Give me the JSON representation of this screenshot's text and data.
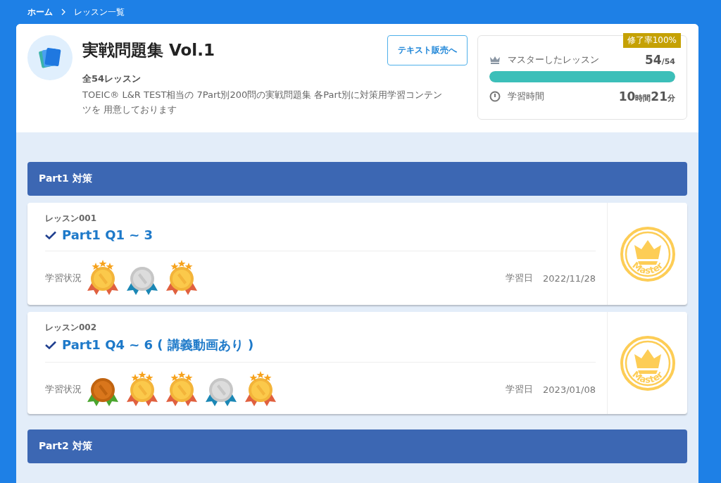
{
  "breadcrumb": [
    {
      "label": "ホーム",
      "current": false
    },
    {
      "label": "レッスン一覧",
      "current": true
    }
  ],
  "course": {
    "title": "実戦問題集 Vol.1",
    "count": "全54レッスン",
    "description": "TOEIC® L&R TEST相当の 7Part別200問の実戦問題集 各Part別に対策用学習コンテンツを 用意しております",
    "shop_button": "テキスト販売へ"
  },
  "stats": {
    "badge": "修了率100%",
    "mastered_label": "マスターしたレッスン",
    "mastered_count": "54",
    "mastered_total": "/54",
    "level": 1,
    "time_label": "学習時間",
    "time_parts": [
      {
        "text": "10",
        "kind": "number"
      },
      {
        "text": "時間",
        "kind": "unit"
      },
      {
        "text": "21",
        "kind": "number"
      },
      {
        "text": "分",
        "kind": "unit"
      }
    ]
  },
  "sections": [
    {
      "title": "Part1 対策",
      "lessons": [
        {
          "number": "レッスン001",
          "title": "Part1 Q1 ~ 3",
          "completed": true,
          "status_label": "学習状況",
          "medals": [
            {
              "kind": "gold"
            },
            {
              "kind": "silver"
            },
            {
              "kind": "gold"
            }
          ],
          "date_label": "学習日",
          "date": "2022/11/28",
          "badge_label": "Master"
        },
        {
          "number": "レッスン002",
          "title": "Part1 Q4 ~ 6 ( 講義動画あり )",
          "completed": true,
          "status_label": "学習状況",
          "medals": [
            {
              "kind": "bronze"
            },
            {
              "kind": "gold"
            },
            {
              "kind": "gold"
            },
            {
              "kind": "silver"
            },
            {
              "kind": "gold"
            }
          ],
          "date_label": "学習日",
          "date": "2023/01/08",
          "badge_label": "Master"
        }
      ]
    },
    {
      "title": "Part2 対策"
    }
  ]
}
